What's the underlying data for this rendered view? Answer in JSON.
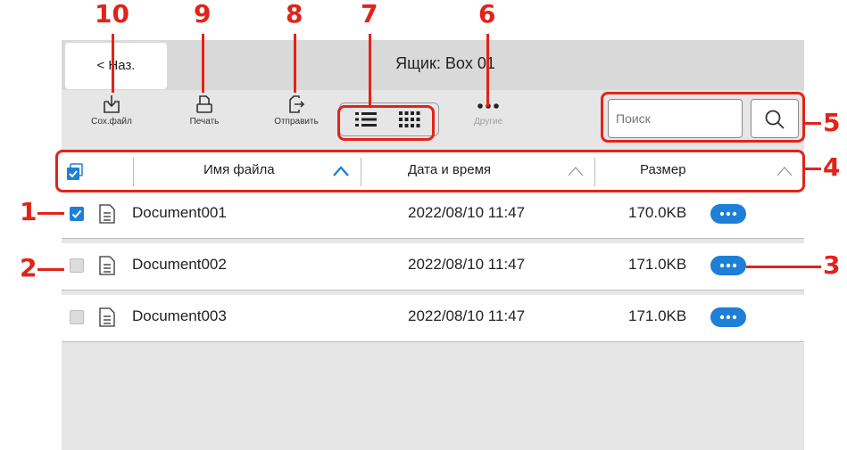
{
  "callouts": {
    "c1": "1",
    "c2": "2",
    "c3": "3",
    "c4": "4",
    "c5": "5",
    "c6": "6",
    "c7": "7",
    "c8": "8",
    "c9": "9",
    "c10": "10"
  },
  "header": {
    "back_label": "< Наз.",
    "title": "Ящик: Box 01"
  },
  "toolbar": {
    "save_label": "Сох.файл",
    "print_label": "Печать",
    "send_label": "Отправить",
    "other_label": "Другие",
    "other_icon": "more-dots-icon",
    "view_list_icon": "list-view-icon",
    "view_grid_icon": "grid-view-icon"
  },
  "search": {
    "placeholder": "Поиск",
    "icon": "search-icon"
  },
  "columns": {
    "name": "Имя файла",
    "date": "Дата и время",
    "size": "Размер"
  },
  "rows": [
    {
      "name": "Document001",
      "date": "2022/08/10 11:47",
      "size": "170.0KB",
      "checked": true
    },
    {
      "name": "Document002",
      "date": "2022/08/10 11:47",
      "size": "171.0KB",
      "checked": false
    },
    {
      "name": "Document003",
      "date": "2022/08/10 11:47",
      "size": "171.0KB",
      "checked": false
    }
  ],
  "colors": {
    "callout": "#e2231a",
    "accent": "#1d7fd6"
  }
}
